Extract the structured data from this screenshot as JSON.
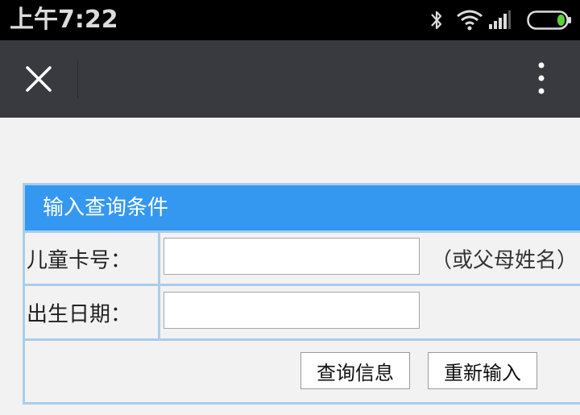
{
  "status_bar": {
    "time": "上午7:22",
    "icons": [
      "bluetooth-icon",
      "wifi-icon",
      "signal-icon",
      "battery-icon"
    ],
    "battery_color": "#59d136"
  },
  "nav_bar": {
    "close_icon": "close-icon",
    "more_icon": "more-vertical-icon",
    "background": "#393a3f"
  },
  "form": {
    "header": "输入查询条件",
    "header_color": "#3498f0",
    "border_color": "#a9cdea",
    "fields": [
      {
        "label": "儿童卡号：",
        "value": "",
        "hint": "（或父母姓名）"
      },
      {
        "label": "出生日期：",
        "value": ""
      }
    ],
    "buttons": {
      "query": "查询信息",
      "reset": "重新输入"
    }
  }
}
